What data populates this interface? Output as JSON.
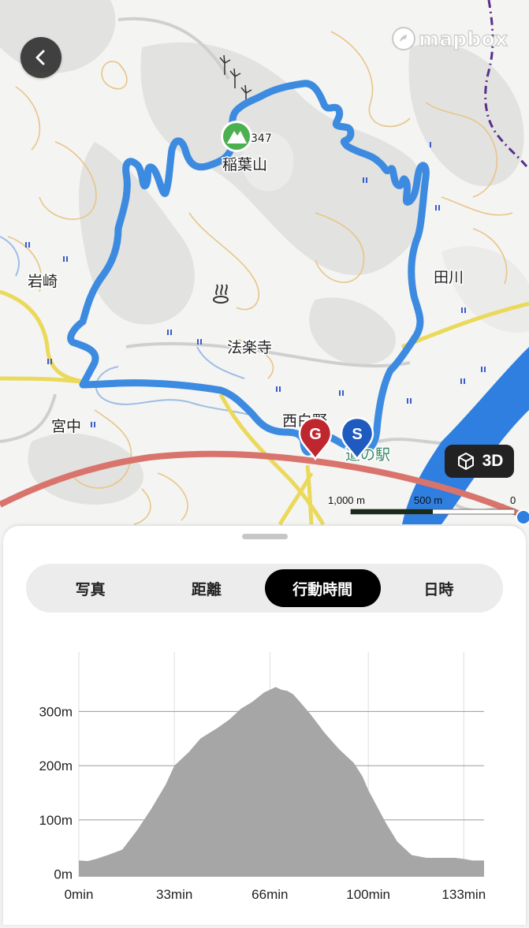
{
  "map": {
    "attribution": "mapbox",
    "place_labels": [
      "稲葉山",
      "347",
      "岩崎",
      "田川",
      "法楽寺",
      "宮中",
      "西白野",
      "道の駅"
    ],
    "markers": {
      "goal": "G",
      "start": "S"
    },
    "view_3d_label": "3D",
    "scale": {
      "left_label": "1,000 m",
      "mid_label": "500 m",
      "right_label": "0"
    },
    "colors": {
      "route": "#3d8be0",
      "goal_marker": "#c0262d",
      "start_marker": "#1f5bbf",
      "summit_marker": "#4caf50"
    }
  },
  "tabs": [
    {
      "label": "写真",
      "active": false
    },
    {
      "label": "距離",
      "active": false
    },
    {
      "label": "行動時間",
      "active": true
    },
    {
      "label": "日時",
      "active": false
    }
  ],
  "chart_data": {
    "type": "area",
    "x": [
      0,
      3,
      6,
      10,
      15,
      20,
      25,
      30,
      33,
      38,
      42,
      48,
      52,
      56,
      60,
      64,
      66,
      68,
      70,
      72,
      74,
      76,
      80,
      85,
      90,
      95,
      98,
      100,
      103,
      106,
      110,
      115,
      120,
      125,
      130,
      133,
      136,
      140
    ],
    "y": [
      25,
      24,
      28,
      35,
      45,
      80,
      120,
      165,
      200,
      225,
      250,
      270,
      285,
      305,
      318,
      335,
      340,
      345,
      340,
      338,
      332,
      320,
      295,
      260,
      230,
      205,
      180,
      155,
      125,
      95,
      60,
      35,
      30,
      30,
      30,
      28,
      25,
      25
    ],
    "xlabel": "",
    "ylabel": "",
    "xticks": [
      "0min",
      "33min",
      "66min",
      "100min",
      "133min"
    ],
    "xtick_values": [
      0,
      33,
      66,
      100,
      133
    ],
    "yticks": [
      "0m",
      "100m",
      "200m",
      "300m"
    ],
    "ytick_values": [
      0,
      100,
      200,
      300
    ],
    "xlim": [
      0,
      140
    ],
    "ylim": [
      -5,
      395
    ],
    "grid": true,
    "fill_color": "#a6a6a6"
  }
}
